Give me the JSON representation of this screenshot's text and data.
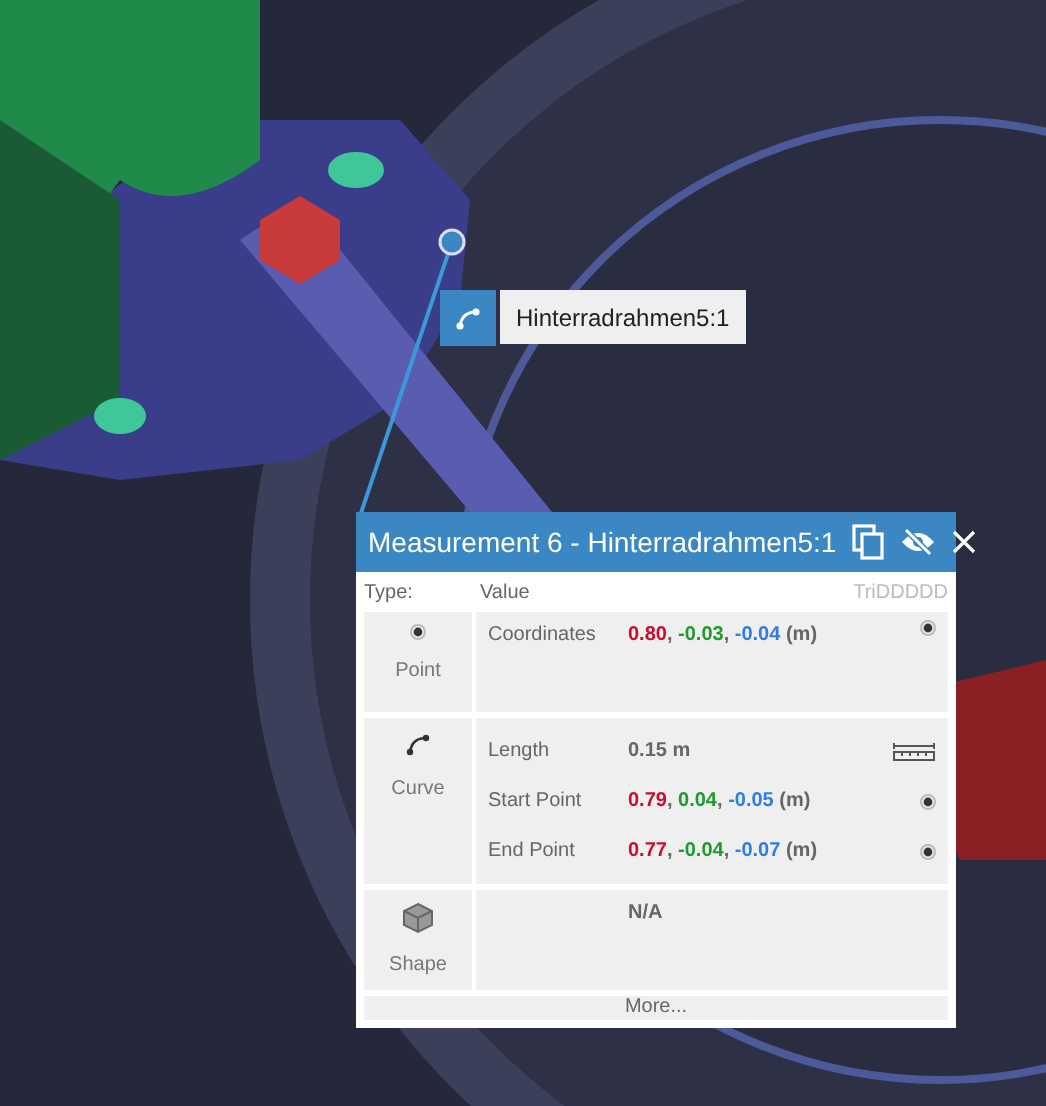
{
  "label": {
    "text": "Hinterradrahmen5:1"
  },
  "panel": {
    "title": "Measurement 6 - Hinterradrahmen5:1",
    "columns": [
      "Type:",
      "Value",
      "TriDDDDD"
    ],
    "groups": [
      {
        "kind": "point",
        "name": "Point",
        "rows": [
          {
            "label": "Coordinates",
            "unit": "(m)",
            "separator": ",",
            "kind": "point",
            "components": [
              {
                "text": "0.80",
                "color": "#c8102e"
              },
              {
                "text": "-0.03",
                "color": "#1f9a2e"
              },
              {
                "text": "-0.04",
                "color": "#2f7de1"
              }
            ]
          }
        ]
      },
      {
        "kind": "curve",
        "name": "Curve",
        "rows": [
          {
            "label": "Length",
            "value": "0.15 m",
            "kind": "ruler"
          },
          {
            "label": "Start Point",
            "unit": "(m)",
            "separator": ",",
            "kind": "point",
            "components": [
              {
                "text": "0.79",
                "color": "#c8102e"
              },
              {
                "text": "0.04",
                "color": "#1f9a2e"
              },
              {
                "text": "-0.05",
                "color": "#2f7de1"
              }
            ]
          },
          {
            "label": "End Point",
            "unit": "(m)",
            "separator": ",",
            "kind": "point",
            "components": [
              {
                "text": "0.77",
                "color": "#c8102e"
              },
              {
                "text": "-0.04",
                "color": "#1f9a2e"
              },
              {
                "text": "-0.07",
                "color": "#2f7de1"
              }
            ]
          }
        ]
      },
      {
        "kind": "shape",
        "name": "Shape",
        "rows": [
          {
            "value": "N/A"
          }
        ]
      }
    ],
    "more": "More..."
  }
}
